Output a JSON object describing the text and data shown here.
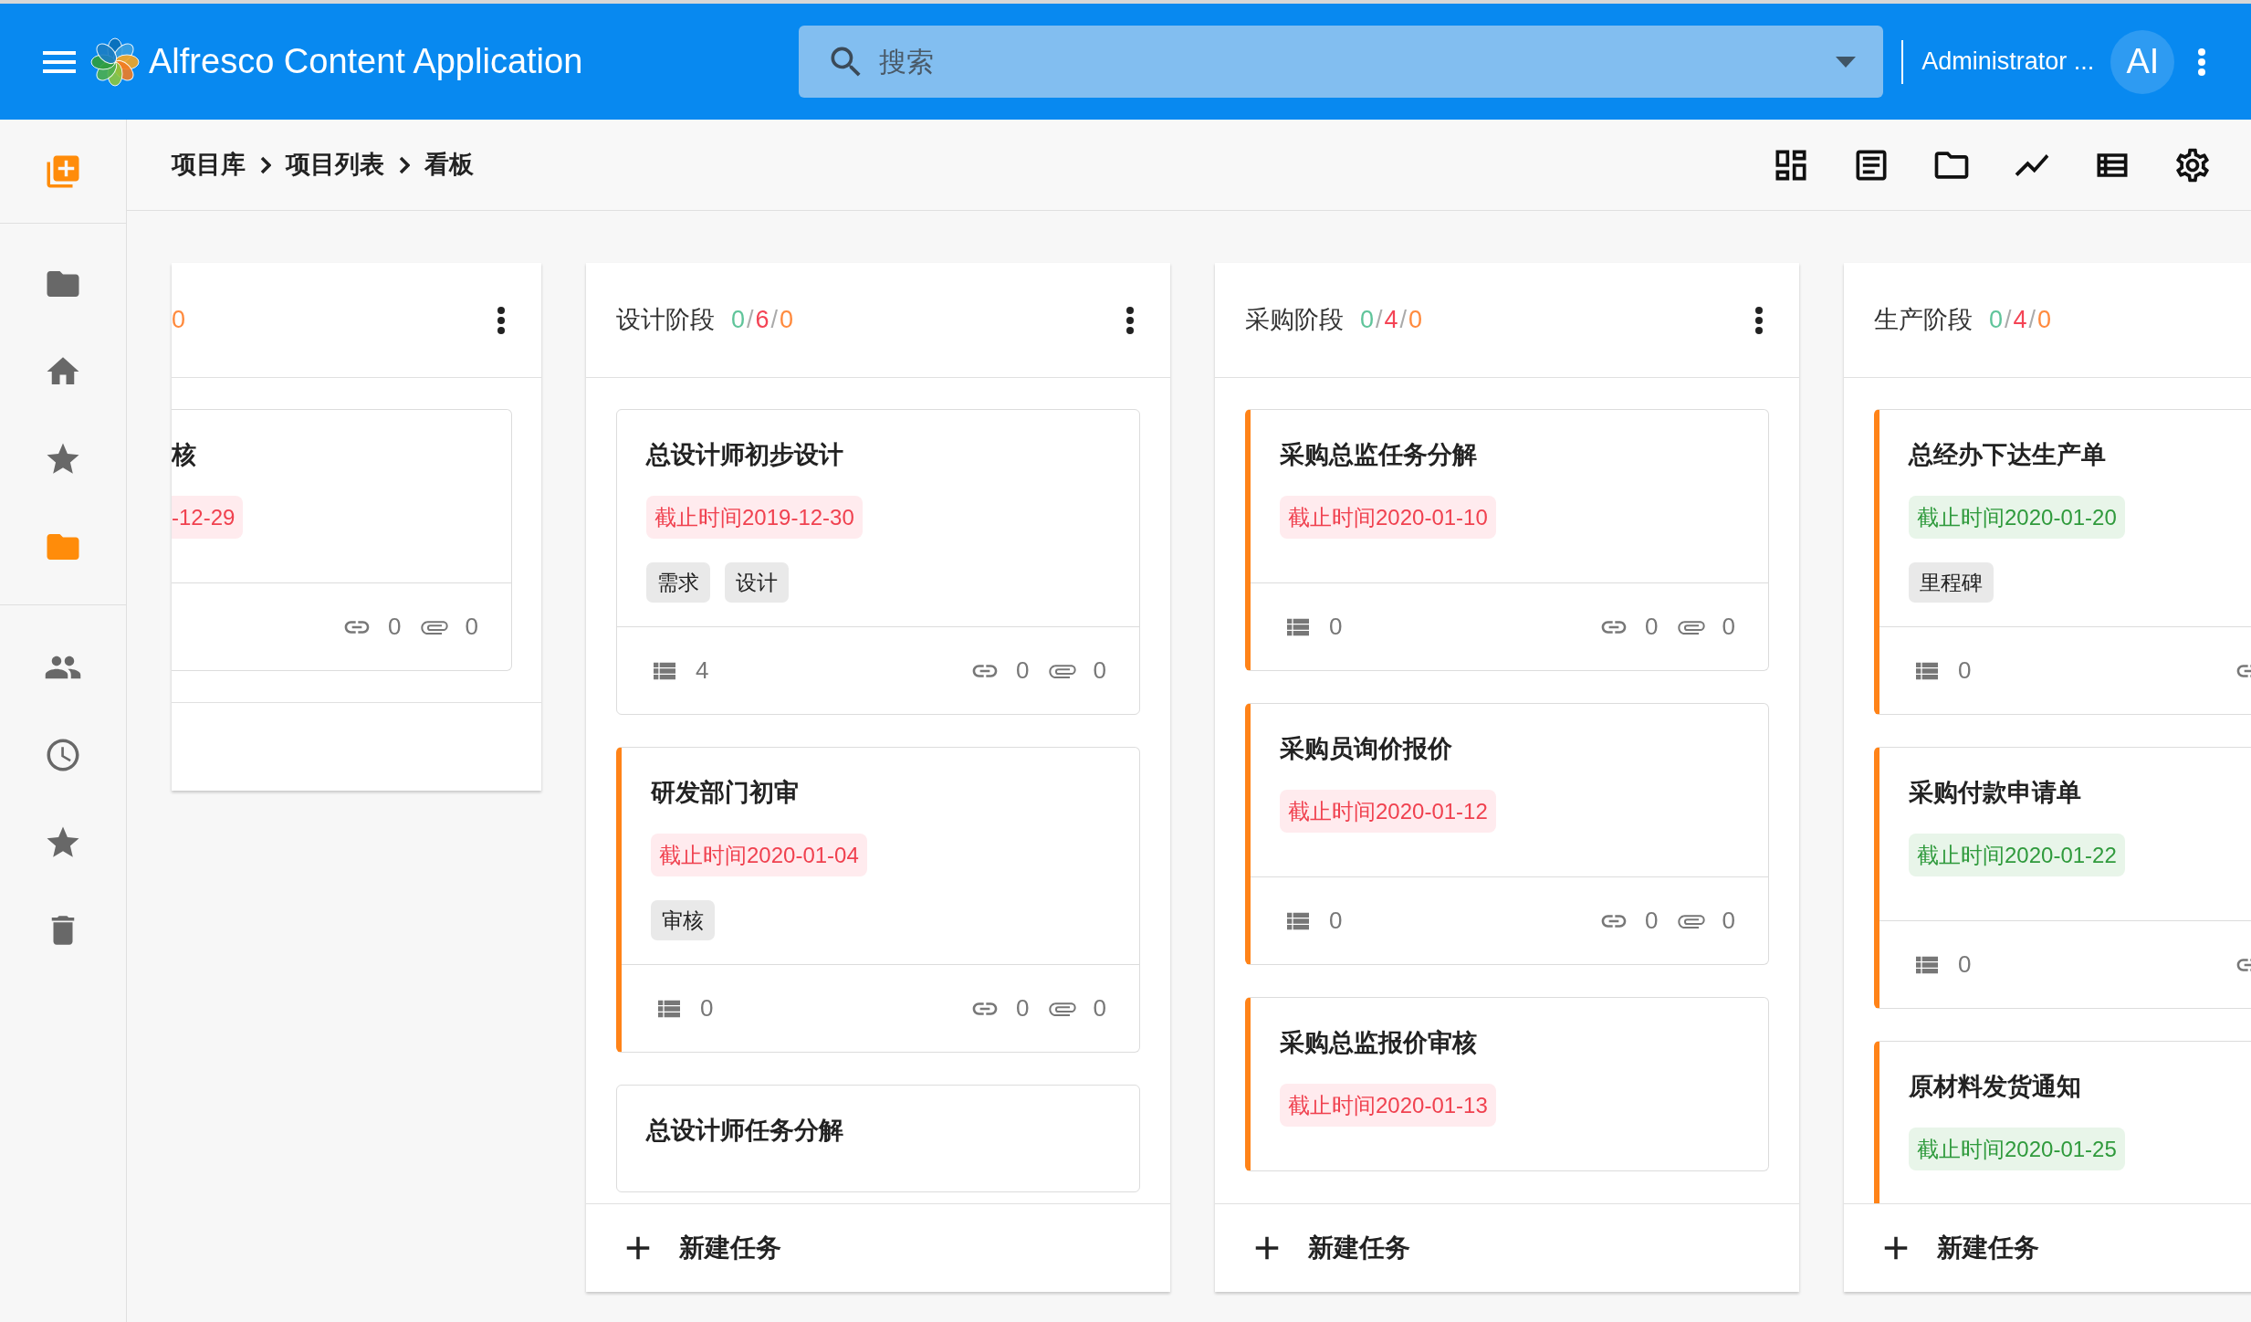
{
  "top_bar": {
    "title": "Alfresco Content Application",
    "search": {
      "placeholder": "搜索"
    },
    "user": "Administrator ...",
    "avatar": "AI"
  },
  "sidebar": {
    "groups": [
      {
        "items": [
          {
            "kind": "action"
          }
        ]
      },
      {
        "items": [
          {
            "selected": false
          },
          {
            "selected": false
          },
          {
            "selected": false
          },
          {
            "selected": true
          }
        ]
      },
      {
        "items": [
          {
            "selected": false
          },
          {
            "selected": false
          },
          {
            "selected": false
          },
          {
            "selected": false
          }
        ]
      }
    ]
  },
  "breadcrumb": {
    "items": [
      "项目库",
      "项目列表",
      "看板"
    ]
  },
  "board": {
    "columns": [
      {
        "kind": "clipped",
        "menu": true,
        "counts": [
          {
            "value": "0",
            "color": "#ff8a3d"
          }
        ],
        "cards": [
          {
            "title": "核",
            "flagged": false,
            "due": {
              "text": "-12-29",
              "overdue": true
            },
            "meta": [
              {
                "kind": "links",
                "count": "0"
              },
              {
                "kind": "attachments",
                "count": "0"
              }
            ]
          }
        ]
      },
      {
        "kind": "full",
        "menu": true,
        "title": "设计阶段",
        "separator": "/",
        "counts": [
          {
            "value": "0",
            "color": "#5fc49a"
          },
          {
            "value": "6",
            "color": "#f44455"
          },
          {
            "value": "0",
            "color": "#ff8a3d"
          }
        ],
        "new_task": "新建任务",
        "cards": [
          {
            "title": "总设计师初步设计",
            "flagged": false,
            "due": {
              "text": "截止时间2019-12-30",
              "overdue": true
            },
            "tags": [
              "需求",
              "设计"
            ],
            "meta": [
              {
                "kind": "subtasks",
                "count": "4"
              },
              {
                "kind": "links",
                "count": "0"
              },
              {
                "kind": "attachments",
                "count": "0"
              }
            ]
          },
          {
            "title": "研发部门初审",
            "flagged": true,
            "due": {
              "text": "截止时间2020-01-04",
              "overdue": true
            },
            "tags": [
              "审核"
            ],
            "meta": [
              {
                "kind": "subtasks",
                "count": "0"
              },
              {
                "kind": "links",
                "count": "0"
              },
              {
                "kind": "attachments",
                "count": "0"
              }
            ]
          },
          {
            "title": "总设计师任务分解",
            "flagged": false
          }
        ]
      },
      {
        "kind": "full",
        "menu": true,
        "title": "采购阶段",
        "separator": "/",
        "counts": [
          {
            "value": "0",
            "color": "#5fc49a"
          },
          {
            "value": "4",
            "color": "#f44455"
          },
          {
            "value": "0",
            "color": "#ff8a3d"
          }
        ],
        "new_task": "新建任务",
        "cards": [
          {
            "title": "采购总监任务分解",
            "flagged": true,
            "due": {
              "text": "截止时间2020-01-10",
              "overdue": true
            },
            "meta": [
              {
                "kind": "subtasks",
                "count": "0"
              },
              {
                "kind": "links",
                "count": "0"
              },
              {
                "kind": "attachments",
                "count": "0"
              }
            ]
          },
          {
            "title": "采购员询价报价",
            "flagged": true,
            "due": {
              "text": "截止时间2020-01-12",
              "overdue": true
            },
            "meta": [
              {
                "kind": "subtasks",
                "count": "0"
              },
              {
                "kind": "links",
                "count": "0"
              },
              {
                "kind": "attachments",
                "count": "0"
              }
            ]
          },
          {
            "title": "采购总监报价审核",
            "flagged": true,
            "due": {
              "text": "截止时间2020-01-13",
              "overdue": true
            }
          }
        ]
      },
      {
        "kind": "full",
        "title": "生产阶段",
        "separator": "/",
        "counts": [
          {
            "value": "0",
            "color": "#5fc49a"
          },
          {
            "value": "4",
            "color": "#f44455"
          },
          {
            "value": "0",
            "color": "#ff8a3d"
          }
        ],
        "new_task": "新建任务",
        "cards": [
          {
            "title": "总经办下达生产单",
            "flagged": true,
            "due": {
              "text": "截止时间2020-01-20",
              "overdue": false
            },
            "tags": [
              "里程碑"
            ],
            "meta": [
              {
                "kind": "subtasks",
                "count": "0"
              },
              {
                "kind": "links"
              }
            ]
          },
          {
            "title": "采购付款申请单",
            "flagged": true,
            "due": {
              "text": "截止时间2020-01-22",
              "overdue": false
            },
            "meta": [
              {
                "kind": "subtasks",
                "count": "0"
              },
              {
                "kind": "links"
              }
            ]
          },
          {
            "title": "原材料发货通知",
            "flagged": true,
            "due": {
              "text": "截止时间2020-01-25",
              "overdue": false
            }
          }
        ]
      }
    ]
  }
}
